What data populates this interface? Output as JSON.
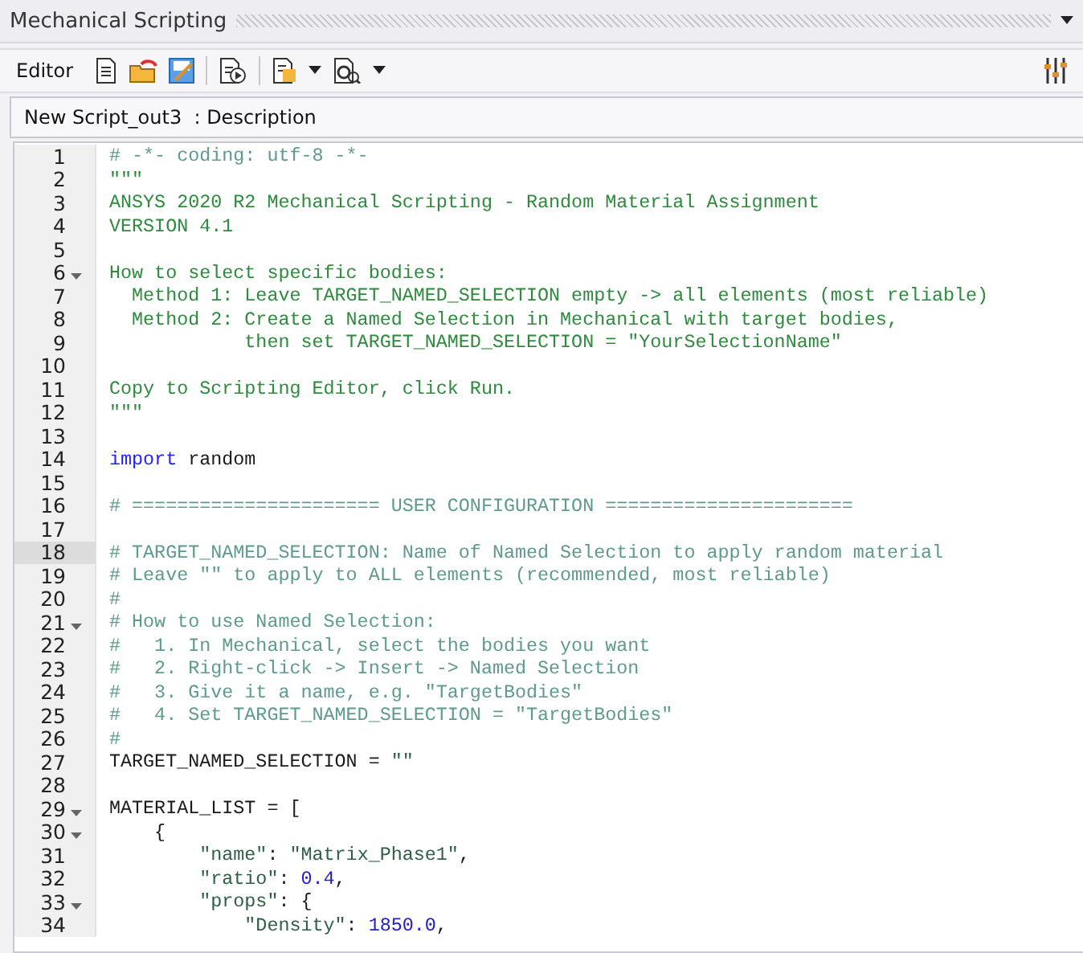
{
  "panel": {
    "title": "Mechanical Scripting"
  },
  "toolbar": {
    "label": "Editor"
  },
  "document_tab": {
    "label": "New Script_out3  : Description"
  },
  "editor": {
    "lines": [
      {
        "number": "1",
        "foldable": false,
        "current": false,
        "tokens": [
          {
            "kind": "comment",
            "text": "# -*- coding: utf-8 -*-"
          }
        ]
      },
      {
        "number": "2",
        "foldable": false,
        "current": false,
        "tokens": [
          {
            "kind": "docstring",
            "text": "\"\"\""
          }
        ]
      },
      {
        "number": "3",
        "foldable": false,
        "current": false,
        "tokens": [
          {
            "kind": "docstring",
            "text": "ANSYS 2020 R2 Mechanical Scripting - Random Material Assignment"
          }
        ]
      },
      {
        "number": "4",
        "foldable": false,
        "current": false,
        "tokens": [
          {
            "kind": "docstring",
            "text": "VERSION 4.1"
          }
        ]
      },
      {
        "number": "5",
        "foldable": false,
        "current": false
      },
      {
        "number": "6",
        "foldable": true,
        "current": false,
        "tokens": [
          {
            "kind": "docstring",
            "text": "How to select specific bodies:"
          }
        ]
      },
      {
        "number": "7",
        "foldable": false,
        "current": false,
        "tokens": [
          {
            "kind": "docstring",
            "text": "  Method 1: Leave TARGET_NAMED_SELECTION empty -> all elements (most reliable)"
          }
        ]
      },
      {
        "number": "8",
        "foldable": false,
        "current": false,
        "tokens": [
          {
            "kind": "docstring",
            "text": "  Method 2: Create a Named Selection in Mechanical with target bodies,"
          }
        ]
      },
      {
        "number": "9",
        "foldable": false,
        "current": false,
        "tokens": [
          {
            "kind": "docstring",
            "text": "            then set TARGET_NAMED_SELECTION = \"YourSelectionName\""
          }
        ]
      },
      {
        "number": "10",
        "foldable": false,
        "current": false
      },
      {
        "number": "11",
        "foldable": false,
        "current": false,
        "tokens": [
          {
            "kind": "docstring",
            "text": "Copy to Scripting Editor, click Run."
          }
        ]
      },
      {
        "number": "12",
        "foldable": false,
        "current": false,
        "tokens": [
          {
            "kind": "docstring",
            "text": "\"\"\""
          }
        ]
      },
      {
        "number": "13",
        "foldable": false,
        "current": false
      },
      {
        "number": "14",
        "foldable": false,
        "current": false,
        "tokens": [
          {
            "kind": "keyword",
            "text": "import"
          },
          {
            "kind": "plain",
            "text": " random"
          }
        ]
      },
      {
        "number": "15",
        "foldable": false,
        "current": false
      },
      {
        "number": "16",
        "foldable": false,
        "current": false,
        "tokens": [
          {
            "kind": "comment",
            "text": "# ====================== USER CONFIGURATION ======================"
          }
        ]
      },
      {
        "number": "17",
        "foldable": false,
        "current": false
      },
      {
        "number": "18",
        "foldable": false,
        "current": true,
        "tokens": [
          {
            "kind": "comment",
            "text": "# TARGET_NAMED_SELECTION: Name of Named Selection to apply random material"
          }
        ]
      },
      {
        "number": "19",
        "foldable": false,
        "current": false,
        "tokens": [
          {
            "kind": "comment",
            "text": "# Leave \"\" to apply to ALL elements (recommended, most reliable)"
          }
        ]
      },
      {
        "number": "20",
        "foldable": false,
        "current": false,
        "tokens": [
          {
            "kind": "comment",
            "text": "#"
          }
        ]
      },
      {
        "number": "21",
        "foldable": true,
        "current": false,
        "tokens": [
          {
            "kind": "comment",
            "text": "# How to use Named Selection:"
          }
        ]
      },
      {
        "number": "22",
        "foldable": false,
        "current": false,
        "tokens": [
          {
            "kind": "comment",
            "text": "#   1. In Mechanical, select the bodies you want"
          }
        ]
      },
      {
        "number": "23",
        "foldable": false,
        "current": false,
        "tokens": [
          {
            "kind": "comment",
            "text": "#   2. Right-click -> Insert -> Named Selection"
          }
        ]
      },
      {
        "number": "24",
        "foldable": false,
        "current": false,
        "tokens": [
          {
            "kind": "comment",
            "text": "#   3. Give it a name, e.g. \"TargetBodies\""
          }
        ]
      },
      {
        "number": "25",
        "foldable": false,
        "current": false,
        "tokens": [
          {
            "kind": "comment",
            "text": "#   4. Set TARGET_NAMED_SELECTION = \"TargetBodies\""
          }
        ]
      },
      {
        "number": "26",
        "foldable": false,
        "current": false,
        "tokens": [
          {
            "kind": "comment",
            "text": "#"
          }
        ]
      },
      {
        "number": "27",
        "foldable": false,
        "current": false,
        "tokens": [
          {
            "kind": "plain",
            "text": "TARGET_NAMED_SELECTION = "
          },
          {
            "kind": "string",
            "text": "\"\""
          }
        ]
      },
      {
        "number": "28",
        "foldable": false,
        "current": false
      },
      {
        "number": "29",
        "foldable": true,
        "current": false,
        "tokens": [
          {
            "kind": "plain",
            "text": "MATERIAL_LIST = ["
          }
        ]
      },
      {
        "number": "30",
        "foldable": true,
        "current": false,
        "tokens": [
          {
            "kind": "plain",
            "text": "    {"
          }
        ]
      },
      {
        "number": "31",
        "foldable": false,
        "current": false,
        "tokens": [
          {
            "kind": "string",
            "text": "        \"name\""
          },
          {
            "kind": "plain",
            "text": ": "
          },
          {
            "kind": "string",
            "text": "\"Matrix_Phase1\""
          },
          {
            "kind": "plain",
            "text": ","
          }
        ]
      },
      {
        "number": "32",
        "foldable": false,
        "current": false,
        "tokens": [
          {
            "kind": "string",
            "text": "        \"ratio\""
          },
          {
            "kind": "plain",
            "text": ": "
          },
          {
            "kind": "number",
            "text": "0.4"
          },
          {
            "kind": "plain",
            "text": ","
          }
        ]
      },
      {
        "number": "33",
        "foldable": true,
        "current": false,
        "tokens": [
          {
            "kind": "string",
            "text": "        \"props\""
          },
          {
            "kind": "plain",
            "text": ": {"
          }
        ]
      },
      {
        "number": "34",
        "foldable": false,
        "current": false,
        "tokens": [
          {
            "kind": "string",
            "text": "            \"Density\""
          },
          {
            "kind": "plain",
            "text": ": "
          },
          {
            "kind": "number",
            "text": "1850.0"
          },
          {
            "kind": "plain",
            "text": ","
          }
        ]
      }
    ]
  }
}
